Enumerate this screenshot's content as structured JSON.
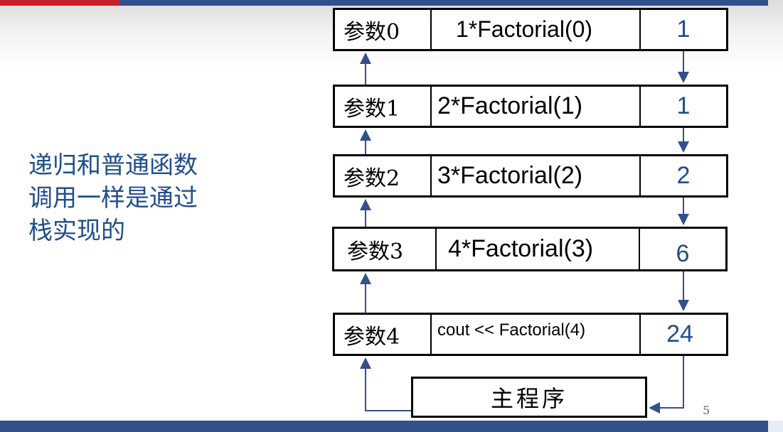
{
  "side_text": [
    "递归和普通函数",
    "调用一样是通过",
    "栈实现的"
  ],
  "frames": [
    {
      "param": "参数0",
      "expr": "1*Factorial(0)",
      "value": "1"
    },
    {
      "param": "参数1",
      "expr": "2*Factorial(1)",
      "value": "1"
    },
    {
      "param": "参数2",
      "expr": "3*Factorial(2)",
      "value": "2"
    },
    {
      "param": "参数3",
      "expr": "4*Factorial(3)",
      "value": "6"
    },
    {
      "param": "参数4",
      "expr": "cout << Factorial(4)",
      "value": "24"
    }
  ],
  "main_label": "主程序",
  "page_number": "5",
  "colors": {
    "accent_blue": "#1f4e8c",
    "bar_blue": "#33508a",
    "bar_red": "#c8202a",
    "arrow": "#33508a"
  }
}
